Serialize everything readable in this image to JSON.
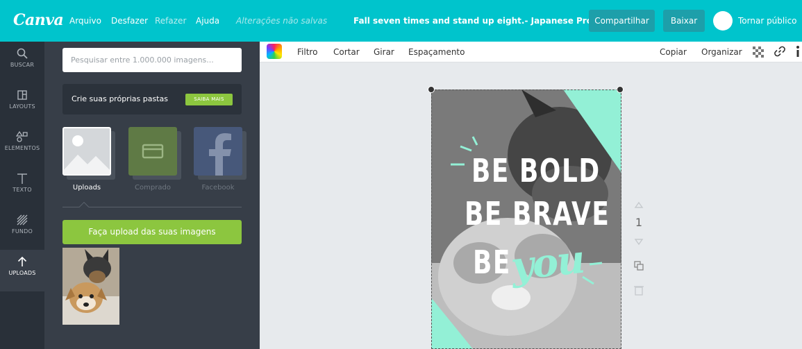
{
  "app": {
    "logo": "Canva",
    "menu": {
      "file": "Arquivo",
      "undo": "Desfazer",
      "redo": "Refazer",
      "help": "Ajuda",
      "unsaved": "Alterações não salvas"
    },
    "document_title": "Fall seven times and stand up eight.- Japanese Proverb",
    "share_label": "Compartilhar",
    "download_label": "Baixar",
    "make_public_label": "Tornar público"
  },
  "rail": {
    "items": [
      {
        "label": "BUSCAR",
        "icon": "search-icon"
      },
      {
        "label": "LAYOUTS",
        "icon": "layouts-icon"
      },
      {
        "label": "ELEMENTOS",
        "icon": "shapes-icon"
      },
      {
        "label": "TEXTO",
        "icon": "text-icon"
      },
      {
        "label": "FUNDO",
        "icon": "background-icon"
      },
      {
        "label": "UPLOADS",
        "icon": "upload-arrow-icon",
        "active": true
      }
    ]
  },
  "panel": {
    "search_placeholder": "Pesquisar entre 1.000.000 imagens...",
    "folders_text": "Crie suas próprias pastas",
    "learn_more_label": "SAIBA MAIS",
    "sources": [
      {
        "label": "Uploads",
        "active": true
      },
      {
        "label": "Comprado",
        "active": false
      },
      {
        "label": "Facebook",
        "active": false
      }
    ],
    "upload_button_label": "Faça upload das suas imagens"
  },
  "toolbar": {
    "filter": "Filtro",
    "crop": "Cortar",
    "rotate": "Girar",
    "spacing": "Espaçamento",
    "copy": "Copiar",
    "arrange": "Organizar"
  },
  "design": {
    "line1": "BE BOLD",
    "line2": "BE BRAVE",
    "line3": "BE",
    "accent": "you",
    "accent_color": "#93f0d6"
  },
  "page_number": "1",
  "colors": {
    "brand": "#00c4cc",
    "green": "#8cc63f",
    "rail": "#293039",
    "panel": "#373e48"
  }
}
